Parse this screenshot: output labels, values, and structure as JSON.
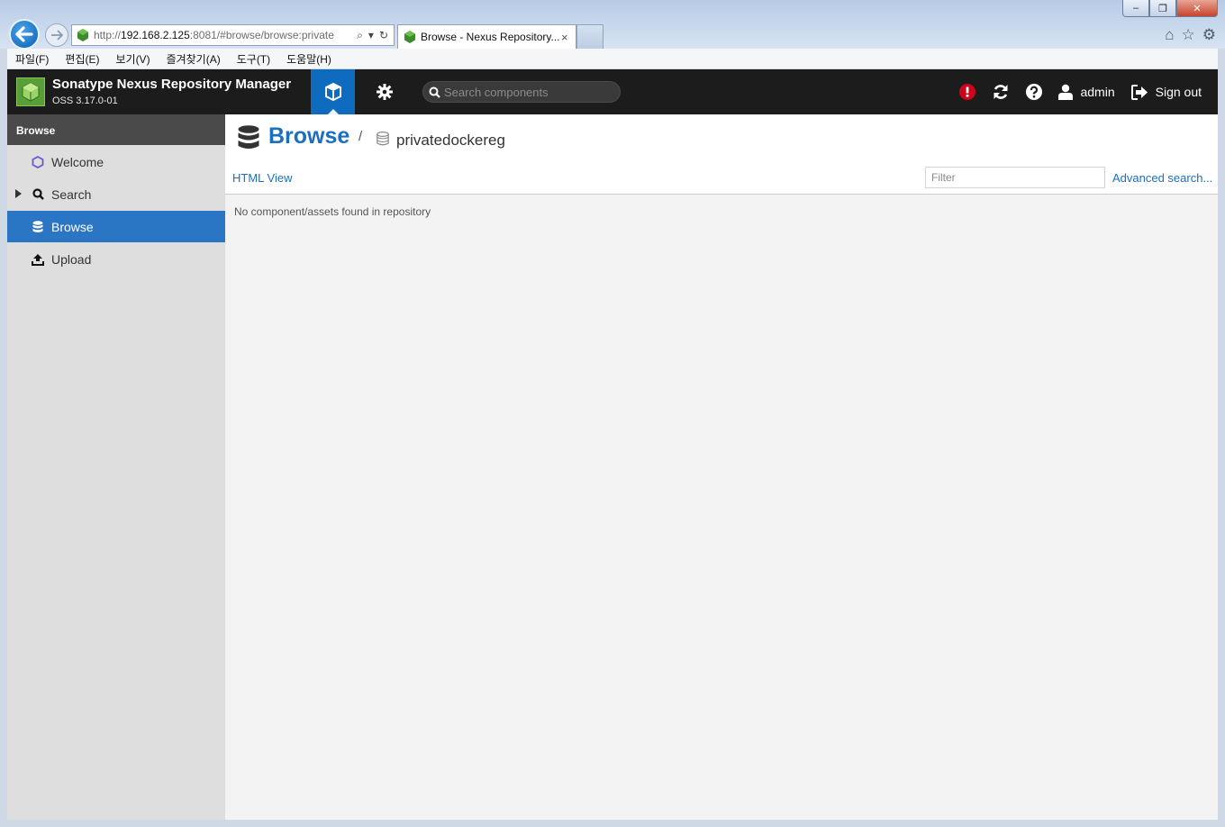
{
  "browser": {
    "url_plain": "http://",
    "url_host": "192.168.2.125",
    "url_rest": ":8081/#browse/browse:private",
    "tab_title": "Browse - Nexus Repository...",
    "tab_close": "×",
    "menu": [
      "파일(F)",
      "편집(E)",
      "보기(V)",
      "즐겨찾기(A)",
      "도구(T)",
      "도움말(H)"
    ],
    "window_buttons": {
      "minimize": "–",
      "maximize": "❐",
      "close": "✕"
    }
  },
  "header": {
    "title": "Sonatype Nexus Repository Manager",
    "version": "OSS 3.17.0-01",
    "search_placeholder": "Search components",
    "user": "admin",
    "sign_out": "Sign out"
  },
  "sidebar": {
    "heading": "Browse",
    "items": [
      {
        "label": "Welcome"
      },
      {
        "label": "Search"
      },
      {
        "label": "Browse"
      },
      {
        "label": "Upload"
      }
    ]
  },
  "main": {
    "title": "Browse",
    "separator": "/",
    "repository": "privatedockereg",
    "html_view": "HTML View",
    "filter_placeholder": "Filter",
    "advanced_search": "Advanced search...",
    "empty_message": "No component/assets found in repository"
  },
  "colors": {
    "accent": "#1d6fbd",
    "header_bg": "#1c1c1c",
    "sidebar_active": "#2a76c4",
    "alert": "#d0021b"
  }
}
